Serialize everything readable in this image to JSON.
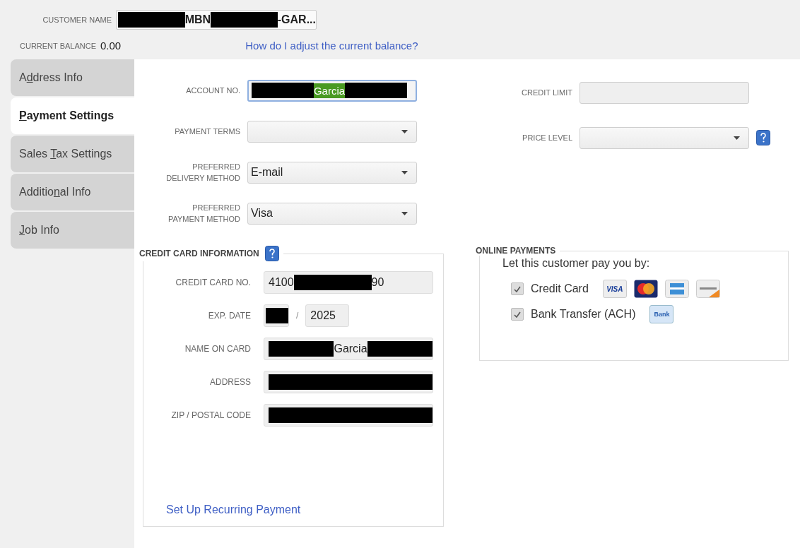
{
  "header": {
    "customer_name": {
      "label": "CUSTOMER NAME",
      "value": [
        {
          "kind": "redacted"
        },
        {
          "kind": "text",
          "text": "MBN"
        },
        {
          "kind": "redacted"
        },
        {
          "kind": "text",
          "text": "-GAR..."
        }
      ]
    },
    "current_balance": {
      "label": "CURRENT BALANCE",
      "value": "0.00"
    },
    "help_link": "How do I adjust the current balance?"
  },
  "tabs": [
    {
      "before": "A",
      "key": "d",
      "after": "dress Info",
      "selected": false
    },
    {
      "key": "P",
      "after": "ayment Settings",
      "selected": true
    },
    {
      "before": "Sales ",
      "key": "T",
      "after": "ax Settings",
      "selected": false
    },
    {
      "before": "Additio",
      "key": "n",
      "after": "al Info",
      "selected": false
    },
    {
      "key": "J",
      "after": "ob Info",
      "selected": false
    }
  ],
  "fields_left": [
    {
      "kind": "text",
      "label": [
        "ACCOUNT NO."
      ],
      "focused": true,
      "value": [
        {
          "kind": "redacted"
        },
        {
          "kind": "highlighted",
          "text": "Garcia"
        },
        {
          "kind": "redacted"
        }
      ]
    },
    {
      "kind": "dropdown",
      "label": [
        "PAYMENT TERMS"
      ],
      "focused": false
    },
    {
      "kind": "dropdown",
      "label": [
        "PREFERRED",
        "DELIVERY METHOD"
      ],
      "focused": false,
      "value": [
        {
          "kind": "text",
          "text": "E-mail"
        }
      ]
    },
    {
      "kind": "dropdown",
      "label": [
        "PREFERRED",
        "PAYMENT METHOD"
      ],
      "focused": false,
      "value": [
        {
          "kind": "text",
          "text": "Visa"
        }
      ]
    }
  ],
  "fields_right": [
    {
      "kind": "text",
      "label": [
        "CREDIT LIMIT"
      ],
      "focused": false
    },
    {
      "kind": "dropdown",
      "label": [
        "PRICE LEVEL"
      ],
      "focused": false,
      "help": true
    }
  ],
  "credit_card": {
    "title": "CREDIT CARD INFORMATION",
    "help": true,
    "rows": [
      {
        "kind": "text",
        "label": "CREDIT CARD NO.",
        "value": [
          {
            "kind": "text",
            "text": "4100"
          },
          {
            "kind": "redacted"
          },
          {
            "kind": "text",
            "text": "90"
          }
        ]
      },
      {
        "kind": "date",
        "label": "EXP. DATE",
        "month": [
          {
            "kind": "redacted"
          }
        ],
        "separator": "/",
        "year": "2025"
      },
      {
        "kind": "text",
        "label": "NAME ON CARD",
        "value": [
          {
            "kind": "redacted"
          },
          {
            "kind": "text",
            "text": "Garcia"
          },
          {
            "kind": "redacted"
          }
        ]
      },
      {
        "kind": "text",
        "label": "ADDRESS",
        "value": [
          {
            "kind": "redacted"
          }
        ]
      },
      {
        "kind": "text",
        "label": "ZIP / POSTAL CODE",
        "value": [
          {
            "kind": "redacted"
          }
        ]
      }
    ],
    "link": "Set Up Recurring Payment"
  },
  "online_payments": {
    "title": "ONLINE PAYMENTS",
    "intro": "Let this customer pay you by:",
    "options": [
      {
        "label": "Credit Card",
        "checked": true,
        "logos": [
          {
            "kind": "visa",
            "text": "VISA"
          },
          {
            "kind": "mastercard"
          },
          {
            "kind": "amex"
          },
          {
            "kind": "discover"
          }
        ]
      },
      {
        "label": "Bank Transfer (ACH)",
        "checked": true,
        "logos": [
          {
            "kind": "bank",
            "text": "Bank"
          }
        ]
      }
    ]
  }
}
